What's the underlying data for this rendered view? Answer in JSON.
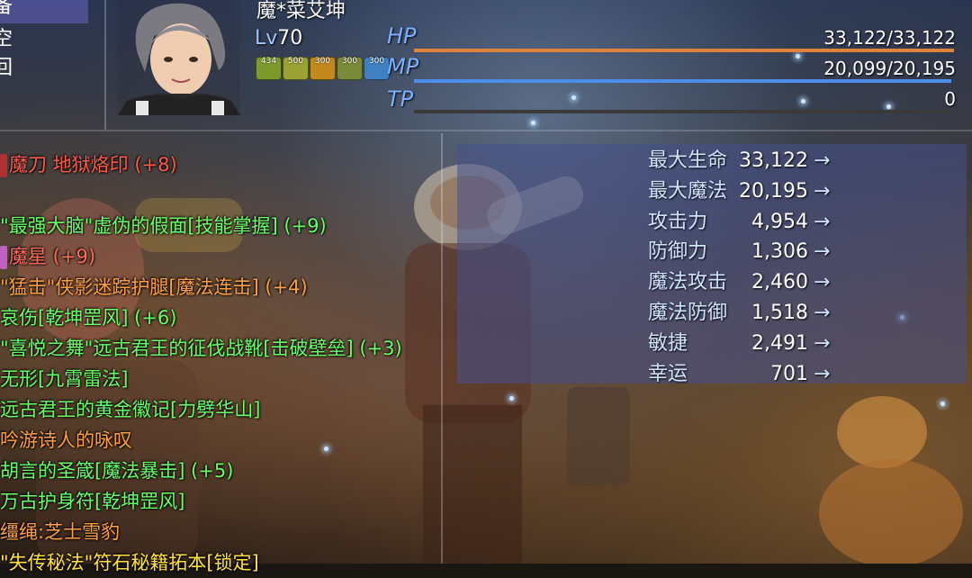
{
  "commands": [
    "备",
    "空",
    "回"
  ],
  "actor": {
    "name": "魔*菜艾坤",
    "level_label": "Lv",
    "level": "70",
    "hp_label": "HP",
    "hp_text": "33,122/33,122",
    "hp_fraction": 1.0,
    "mp_label": "MP",
    "mp_text": "20,099/20,195",
    "mp_fraction": 0.995,
    "tp_label": "TP",
    "tp_text": "0",
    "tp_fraction": 0.0,
    "hp_color": "#e0833a",
    "mp_color": "#4c8ee8",
    "tp_color": "#6fa0d0"
  },
  "states": [
    {
      "text": "434",
      "color": "#7c9a2c"
    },
    {
      "text": "500",
      "color": "#9aa234"
    },
    {
      "text": "300",
      "color": "#c28a1e"
    },
    {
      "text": "300",
      "color": "#7a8a3a"
    },
    {
      "text": "300",
      "color": "#3f7fc4"
    }
  ],
  "equipment": [
    {
      "text": "魔刀 地狱烙印 (+8)",
      "color": "#ff5a4a",
      "icon": "#b03030"
    },
    {
      "text": "",
      "color": "#ffffff",
      "icon": ""
    },
    {
      "text": "\"最强大脑\"虚伪的假面[技能掌握] (+9)",
      "color": "#66ff66",
      "icon": ""
    },
    {
      "text": "魔星 (+9)",
      "color": "#ff6a5a",
      "icon": "#c060c0"
    },
    {
      "text": "\"猛击\"侠影迷踪护腿[魔法连击] (+4)",
      "color": "#ffa040",
      "icon": ""
    },
    {
      "text": "哀伤[乾坤罡风] (+6)",
      "color": "#66ff66",
      "icon": ""
    },
    {
      "text": "\"喜悦之舞\"远古君王的征伐战靴[击破壁垒] (+3)",
      "color": "#66ff66",
      "icon": ""
    },
    {
      "text": "无形[九霄雷法]",
      "color": "#66ff66",
      "icon": ""
    },
    {
      "text": "远古君王的黄金徽记[力劈华山]",
      "color": "#66ff66",
      "icon": ""
    },
    {
      "text": "吟游诗人的咏叹",
      "color": "#ffa040",
      "icon": ""
    },
    {
      "text": "胡言的圣箴[魔法暴击] (+5)",
      "color": "#66ff66",
      "icon": ""
    },
    {
      "text": "万古护身符[乾坤罡风]",
      "color": "#66ff66",
      "icon": ""
    },
    {
      "text": "缰绳:芝士雪豹",
      "color": "#ffa040",
      "icon": ""
    },
    {
      "text": "\"失传秘法\"符石秘籍拓本[锁定]",
      "color": "#ffe040",
      "icon": ""
    }
  ],
  "stats": [
    {
      "name": "最大生命",
      "value": "33,122",
      "arrow": "→"
    },
    {
      "name": "最大魔法",
      "value": "20,195",
      "arrow": "→"
    },
    {
      "name": "攻击力",
      "value": "4,954",
      "arrow": "→"
    },
    {
      "name": "防御力",
      "value": "1,306",
      "arrow": "→"
    },
    {
      "name": "魔法攻击",
      "value": "2,460",
      "arrow": "→"
    },
    {
      "name": "魔法防御",
      "value": "1,518",
      "arrow": "→"
    },
    {
      "name": "敏捷",
      "value": "2,491",
      "arrow": "→"
    },
    {
      "name": "幸运",
      "value": "701",
      "arrow": "→"
    }
  ]
}
